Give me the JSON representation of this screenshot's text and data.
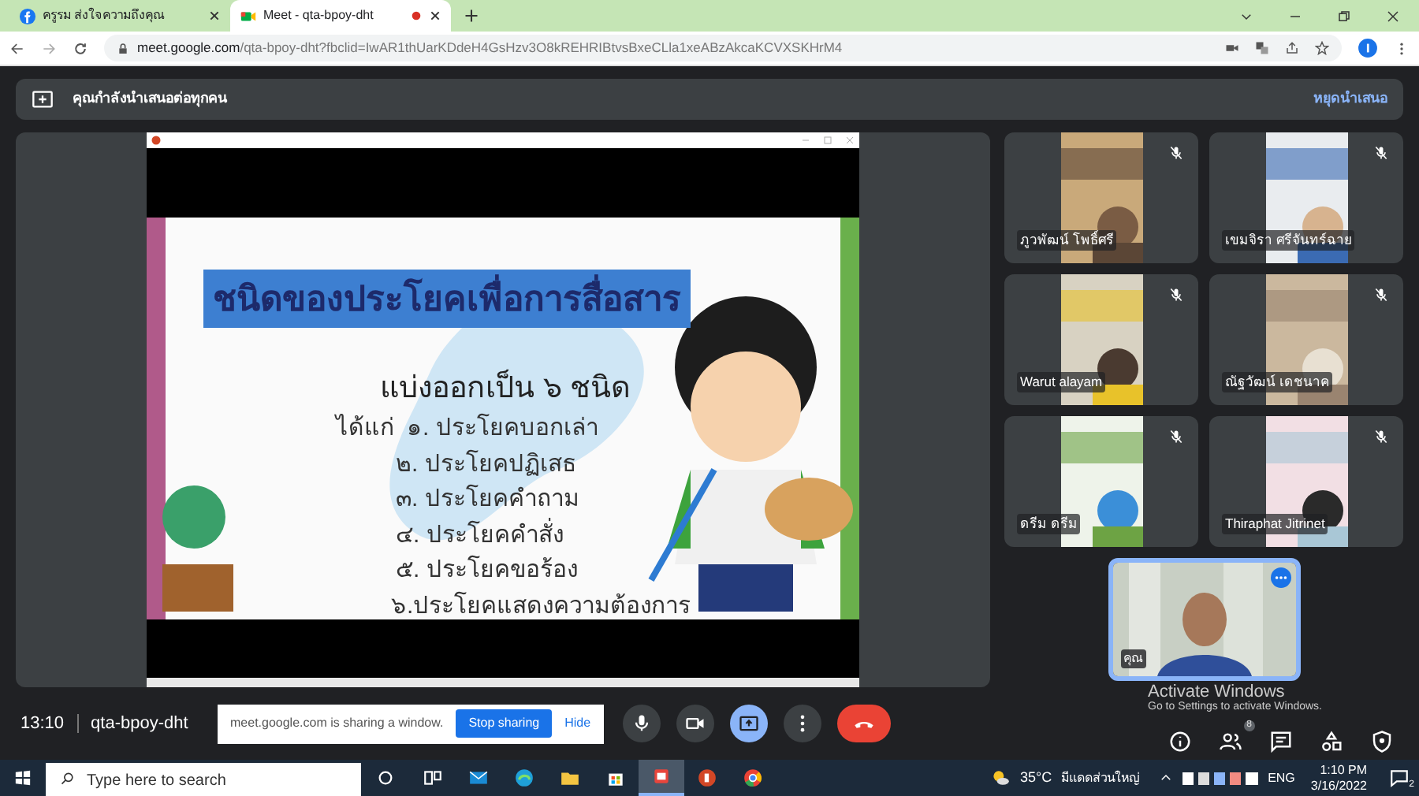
{
  "browser": {
    "tabs": [
      {
        "kind": "facebook",
        "title": "ครูรม ส่งใจความถึงคุณ",
        "selected": false
      },
      {
        "kind": "meet",
        "title": "Meet - qta-bpoy-dht",
        "selected": true
      }
    ],
    "url_host": "meet.google.com",
    "url_path": "/qta-bpoy-dht?fbclid=IwAR1thUarKDdeH4GsHzv3O8kREHRIBtvsBxeCLla1xeABzAkcaKCVXSKHrM4"
  },
  "banner": {
    "message": "คุณกำลังนำเสนอต่อทุกคน",
    "action": "หยุดนำเสนอ"
  },
  "slide": {
    "title": "ชนิดของประโยคเพื่อการสื่อสาร",
    "subtitle": "แบ่งออกเป็น ๖ ชนิด",
    "lead": "ได้แก่",
    "items": [
      "๑. ประโยคบอกเล่า",
      "๒. ประโยคปฏิเสธ",
      "๓. ประโยคคำถาม",
      "๔. ประโยคคำสั่ง",
      "๕. ประโยคขอร้อง",
      "๖.ประโยคแสดงความต้องการ"
    ]
  },
  "participants": [
    {
      "name": "ภูวพัฒน์ โพธิ์ศรี",
      "muted": true
    },
    {
      "name": "เขมจิรา ศรีจันทร์ฉาย",
      "muted": true
    },
    {
      "name": "Warut alayam",
      "muted": true
    },
    {
      "name": "ณัฐวัฒน์ เดชนาค",
      "muted": true
    },
    {
      "name": "ดรีม ดรีม",
      "muted": true
    },
    {
      "name": "Thiraphat Jitrinet",
      "muted": true
    }
  ],
  "self_tile": {
    "name": "คุณ"
  },
  "meeting": {
    "time": "13:10",
    "code": "qta-bpoy-dht"
  },
  "sharing_notice": {
    "message": "meet.google.com is sharing a window.",
    "stop": "Stop sharing",
    "hide": "Hide"
  },
  "controls": [
    {
      "kind": "mic",
      "selected": false
    },
    {
      "kind": "camera",
      "selected": false
    },
    {
      "kind": "present",
      "selected": true
    },
    {
      "kind": "more",
      "selected": false
    },
    {
      "kind": "leave",
      "selected": false
    }
  ],
  "right_controls": [
    {
      "kind": "info"
    },
    {
      "kind": "people",
      "badge": "8"
    },
    {
      "kind": "chat"
    },
    {
      "kind": "activities"
    },
    {
      "kind": "host"
    }
  ],
  "activation": {
    "title": "Activate Windows",
    "text": "Go to Settings to activate Windows."
  },
  "taskbar": {
    "search_placeholder": "Type here to search",
    "apps": [
      {
        "kind": "task-view",
        "active": false
      },
      {
        "kind": "mail",
        "active": false
      },
      {
        "kind": "edge",
        "active": false
      },
      {
        "kind": "folder",
        "active": false
      },
      {
        "kind": "store",
        "active": false
      },
      {
        "kind": "present",
        "active": true
      },
      {
        "kind": "powerpoint",
        "active": false
      },
      {
        "kind": "chrome",
        "active": false
      }
    ],
    "weather": "35°C",
    "weather_text": "มีแดดส่วนใหญ่",
    "lang": "ENG",
    "time": "1:10 PM",
    "date": "3/16/2022",
    "notifications": "2"
  }
}
